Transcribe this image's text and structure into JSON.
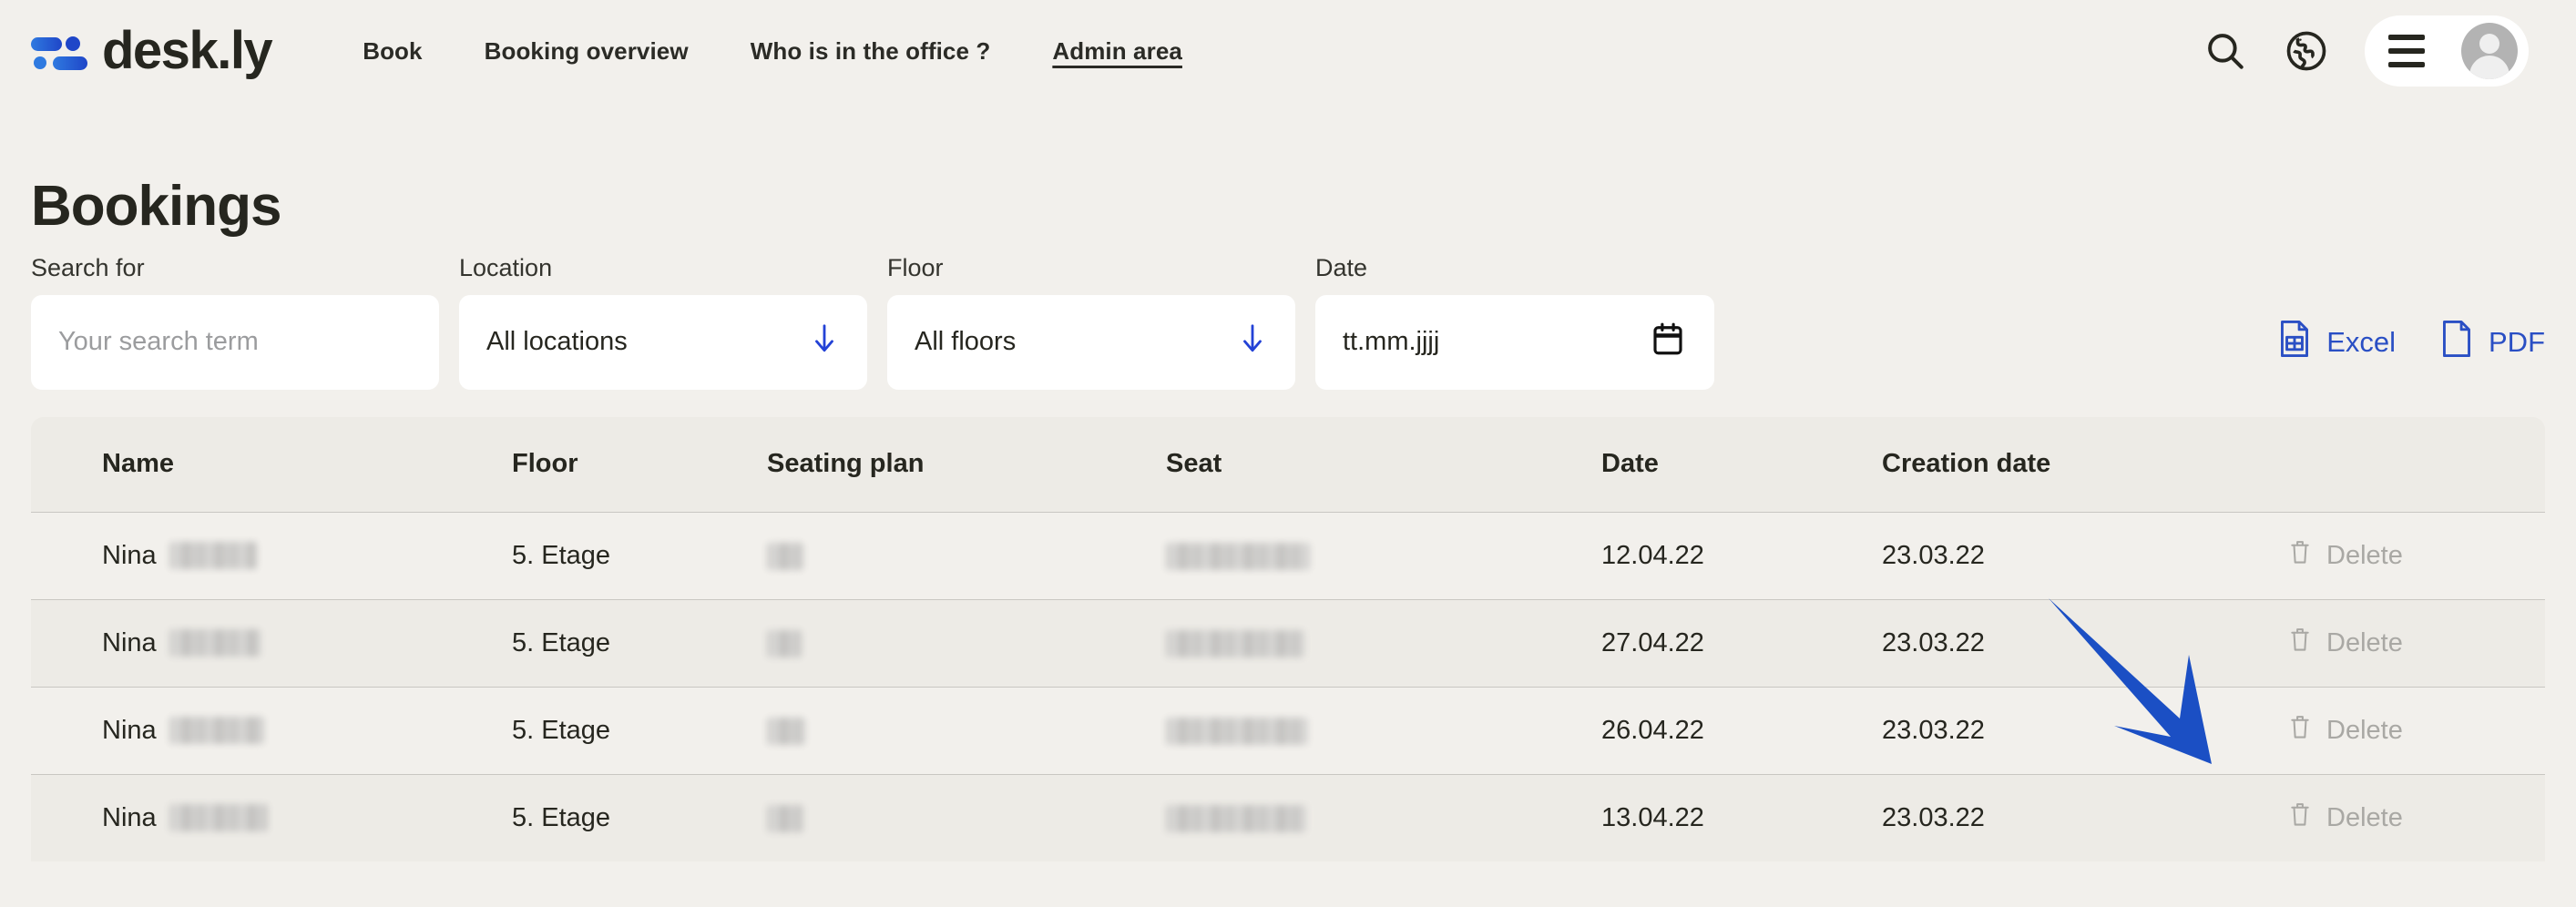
{
  "brand": {
    "name": "desk.ly",
    "logo_icon": "deskly-dots-logo"
  },
  "nav": {
    "items": [
      {
        "label": "Book",
        "active": false
      },
      {
        "label": "Booking overview",
        "active": false
      },
      {
        "label": "Who is in the office ?",
        "active": false
      },
      {
        "label": "Admin area",
        "active": true
      }
    ]
  },
  "top_right": {
    "search_icon": "search-icon",
    "language_icon": "globe-icon",
    "menu_icon": "hamburger-menu-icon",
    "avatar_icon": "user-avatar-icon"
  },
  "page": {
    "title": "Bookings"
  },
  "filters": {
    "search": {
      "label": "Search for",
      "value": "",
      "placeholder": "Your search term"
    },
    "location": {
      "label": "Location",
      "value": "All locations",
      "icon": "arrow-down-icon"
    },
    "floor": {
      "label": "Floor",
      "value": "All floors",
      "icon": "arrow-down-icon"
    },
    "date": {
      "label": "Date",
      "value": "",
      "placeholder": "tt.mm.jjjj",
      "icon": "calendar-icon"
    }
  },
  "exports": [
    {
      "label": "Excel",
      "icon": "excel-file-icon"
    },
    {
      "label": "PDF",
      "icon": "pdf-file-icon"
    }
  ],
  "table": {
    "columns": [
      "Name",
      "Floor",
      "Seating plan",
      "Seat",
      "Date",
      "Creation date"
    ],
    "action_label": "Delete",
    "action_icon": "trash-icon",
    "rows": [
      {
        "name_visible": "Nina",
        "name_redacted_width": 96,
        "floor": "5. Etage",
        "plan_redacted_width": 40,
        "seat_redacted_width": 158,
        "date": "12.04.22",
        "creation_date": "23.03.22",
        "action": "Delete"
      },
      {
        "name_visible": "Nina",
        "name_redacted_width": 100,
        "floor": "5. Etage",
        "plan_redacted_width": 38,
        "seat_redacted_width": 152,
        "date": "27.04.22",
        "creation_date": "23.03.22",
        "action": "Delete"
      },
      {
        "name_visible": "Nina",
        "name_redacted_width": 104,
        "floor": "5. Etage",
        "plan_redacted_width": 42,
        "seat_redacted_width": 156,
        "date": "26.04.22",
        "creation_date": "23.03.22",
        "action": "Delete"
      },
      {
        "name_visible": "Nina",
        "name_redacted_width": 108,
        "floor": "5. Etage",
        "plan_redacted_width": 40,
        "seat_redacted_width": 154,
        "date": "13.04.22",
        "creation_date": "23.03.22",
        "action": "Delete"
      }
    ]
  },
  "annotation": {
    "type": "arrow",
    "points_to": "Delete",
    "color": "#1b4fc4"
  },
  "colors": {
    "page_background": "#f2f0ec",
    "accent_blue": "#2a4fc4",
    "logo_blue": "#2060d8",
    "text_dark": "#26261f",
    "muted": "#a9a8a4",
    "table_header_bg": "#edebe6"
  }
}
